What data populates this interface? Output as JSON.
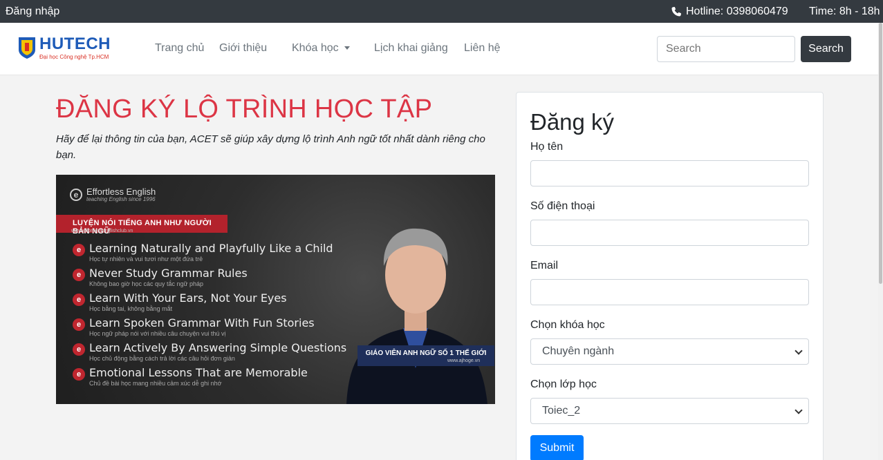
{
  "topbar": {
    "login": "Đăng nhập",
    "hotline": "Hotline: 0398060479",
    "time": "Time: 8h - 18h"
  },
  "logo": {
    "brand": "HUTECH",
    "subtitle": "Đại học Công nghệ Tp.HCM"
  },
  "nav": {
    "home": "Trang chủ",
    "about": "Giới thiệu",
    "courses": "Khóa học",
    "schedule": "Lịch khai giảng",
    "contact": "Liên hệ"
  },
  "search": {
    "placeholder": "Search",
    "button": "Search"
  },
  "main": {
    "title": "ĐĂNG KÝ LỘ TRÌNH HỌC TẬP",
    "subtitle": "Hãy để lại thông tin của bạn, ACET sẽ giúp xây dựng lộ trình Anh ngữ tốt nhất dành riêng cho bạn."
  },
  "banner": {
    "brand": "Effortless English",
    "tagline": "teaching English since 1996",
    "ribbon": "LUYỆN NÓI TIẾNG ANH NHƯ NGƯỜI BẢN NGỮ",
    "site": "www.effortlessenglishclub.vn",
    "lines": [
      {
        "en": "Learning Naturally and Playfully Like a Child",
        "vi": "Học tự nhiên và vui tươi như một đứa trẻ"
      },
      {
        "en": "Never Study Grammar Rules",
        "vi": "Không bao giờ học các quy tắc ngữ pháp"
      },
      {
        "en": "Learn With Your Ears, Not Your Eyes",
        "vi": "Học bằng tai, không bằng mắt"
      },
      {
        "en": "Learn Spoken Grammar With Fun Stories",
        "vi": "Học ngữ pháp nói với nhiều câu chuyện vui thú vị"
      },
      {
        "en": "Learn Actively By Answering Simple Questions",
        "vi": "Học chủ động bằng cách trả lời các câu hỏi đơn giản"
      },
      {
        "en": "Emotional Lessons That are Memorable",
        "vi": "Chủ đề bài học mang nhiều cảm xúc dễ ghi nhớ"
      }
    ],
    "badge": "GIÁO VIÊN ANH NGỮ SỐ 1 THẾ GIỚI",
    "website": "www.ajhoge.vn"
  },
  "form": {
    "title": "Đăng ký",
    "name_label": "Họ tên",
    "phone_label": "Số điện thoại",
    "email_label": "Email",
    "course_label": "Chọn khóa học",
    "course_value": "Chuyên ngành",
    "class_label": "Chọn lớp học",
    "class_value": "Toiec_2",
    "submit": "Submit"
  },
  "colors": {
    "accent": "#dc3545",
    "primary": "#007bff",
    "dark": "#343a40"
  }
}
